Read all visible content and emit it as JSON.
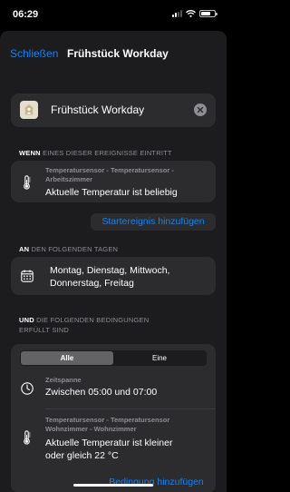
{
  "status": {
    "time": "06:29",
    "battery_level": 0.7
  },
  "nav": {
    "close_label": "Schließen",
    "title": "Frühstück Workday"
  },
  "automation": {
    "name": "Frühstück Workday",
    "icon": "home-person-icon",
    "clear_icon": "clear-icon"
  },
  "when": {
    "label_bold": "WENN",
    "label_rest": " EINES DIESER EREIGNISSE EINTRITT",
    "event": {
      "icon": "thermometer-icon",
      "subtitle": "Temperatursensor - Temperatursensor - Arbeitszimmer",
      "title": "Aktuelle Temperatur ist beliebig"
    },
    "add_label": "Startereignis hinzufügen"
  },
  "days": {
    "label_bold": "AN",
    "label_rest": " DEN FOLGENDEN TAGEN",
    "icon": "calendar-icon",
    "text_line1": "Montag, Dienstag, Mittwoch,",
    "text_line2": "Donnerstag, Freitag"
  },
  "conditions": {
    "label_bold": "UND",
    "label_rest": " DIE FOLGENDEN BEDINGUNGEN",
    "label_line2": "ERFÜLLT SIND",
    "segment": {
      "options": [
        "Alle",
        "Eine"
      ],
      "selected": "Alle"
    },
    "items": [
      {
        "icon": "clock-icon",
        "subtitle": "Zeitspanne",
        "title": "Zwischen 05:00 und 07:00"
      },
      {
        "icon": "thermometer-icon",
        "subtitle_line1": "Temperatursensor - Temperatursensor",
        "subtitle_line2": "Wohnzimmer - Wohnzimmer",
        "title_line1": "Aktuelle Temperatur ist kleiner",
        "title_line2": "oder gleich 22 °C"
      }
    ],
    "add_label": "Bedingung hinzufügen"
  },
  "colors": {
    "accent": "#0a84ff",
    "background": "#1c1c1e",
    "card": "#2c2c2e",
    "secondary_text": "#8e8e93"
  }
}
